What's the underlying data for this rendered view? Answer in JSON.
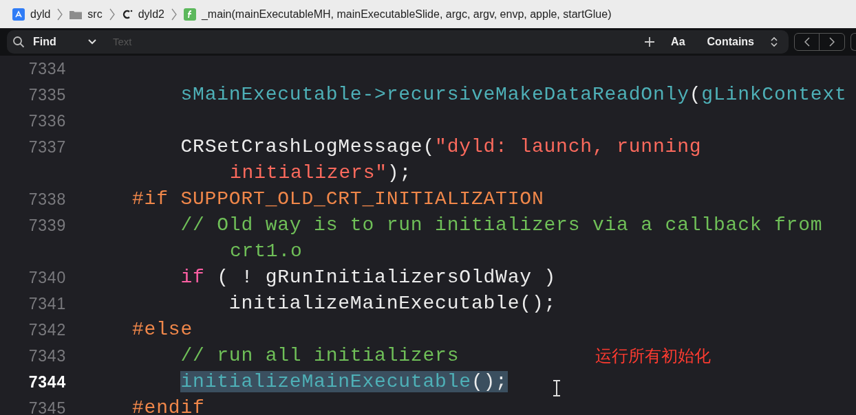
{
  "breadcrumb": [
    {
      "kind": "project",
      "label": "dyld"
    },
    {
      "kind": "folder",
      "label": "src"
    },
    {
      "kind": "c-file",
      "label": "dyld2"
    },
    {
      "kind": "function",
      "label": "_main(mainExecutableMH, mainExecutableSlide, argc, argv, envp, apple, startGlue)"
    }
  ],
  "find_bar": {
    "mode": "Find",
    "placeholder": "Text",
    "case_button": "Aa",
    "match": "Contains"
  },
  "lines": [
    {
      "number": "7334",
      "current": false
    },
    {
      "number": "7335",
      "current": false,
      "tokens": [
        {
          "kind": "function",
          "text": "    sMainExecutable->recursiveMakeDataReadOnly"
        },
        {
          "kind": "plain",
          "text": "("
        },
        {
          "kind": "function",
          "text": "gLinkContext"
        }
      ]
    },
    {
      "number": "7336",
      "current": false
    },
    {
      "number": "7337",
      "current": false,
      "tokens": [
        {
          "kind": "plain",
          "text": "    CRSetCrashLogMessage("
        },
        {
          "kind": "string",
          "text": "\"dyld: launch, running"
        }
      ],
      "wrapped": [
        {
          "kind": "string",
          "text": "initializers\""
        },
        {
          "kind": "plain",
          "text": ");"
        }
      ]
    },
    {
      "number": "7338",
      "current": false,
      "tokens": [
        {
          "kind": "preprocessor",
          "text": "#if SUPPORT_OLD_CRT_INITIALIZATION"
        }
      ]
    },
    {
      "number": "7339",
      "current": false,
      "tokens": [
        {
          "kind": "comment",
          "text": "    // Old way is to run initializers via a callback from"
        }
      ],
      "wrapped": [
        {
          "kind": "comment",
          "text": "crt1.o"
        }
      ]
    },
    {
      "number": "7340",
      "current": false,
      "tokens": [
        {
          "kind": "keyword",
          "text": "    if"
        },
        {
          "kind": "plain",
          "text": " ( ! gRunInitializersOldWay )"
        }
      ]
    },
    {
      "number": "7341",
      "current": false,
      "tokens": [
        {
          "kind": "plain",
          "text": "        initializeMainExecutable();"
        }
      ]
    },
    {
      "number": "7342",
      "current": false,
      "tokens": [
        {
          "kind": "preprocessor",
          "text": "#else"
        }
      ]
    },
    {
      "number": "7343",
      "current": false,
      "tokens": [
        {
          "kind": "comment",
          "text": "    // run all initializers"
        }
      ]
    },
    {
      "number": "7344",
      "current": true,
      "selection": true,
      "tokens": [
        {
          "kind": "function",
          "text": "    initializeMainExecutable"
        },
        {
          "kind": "plain",
          "text": "();"
        }
      ]
    },
    {
      "number": "7345",
      "current": false,
      "tokens": [
        {
          "kind": "preprocessor",
          "text": "#endif"
        }
      ]
    }
  ],
  "annotation": "运行所有初始化"
}
